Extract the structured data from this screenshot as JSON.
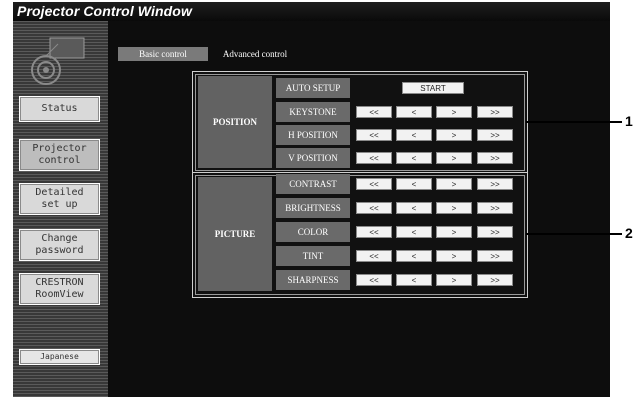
{
  "window": {
    "title": "Projector Control Window"
  },
  "sidebar": {
    "items": [
      {
        "label": "Status"
      },
      {
        "label": "Projector\ncontrol"
      },
      {
        "label": "Detailed\nset up"
      },
      {
        "label": "Change\npassword"
      },
      {
        "label": "CRESTRON\nRoomView"
      }
    ],
    "language_label": "Japanese"
  },
  "tabs": [
    {
      "label": "Basic control",
      "active": true
    },
    {
      "label": "Advanced control",
      "active": false
    }
  ],
  "arrows": {
    "far_left": "<<",
    "left": "<",
    "right": ">",
    "far_right": ">>"
  },
  "position": {
    "label": "POSITION",
    "auto_setup": {
      "label": "AUTO SETUP",
      "button": "START"
    },
    "rows": [
      {
        "label": "KEYSTONE"
      },
      {
        "label": "H POSITION"
      },
      {
        "label": "V POSITION"
      }
    ]
  },
  "picture": {
    "label": "PICTURE",
    "rows": [
      {
        "label": "CONTRAST"
      },
      {
        "label": "BRIGHTNESS"
      },
      {
        "label": "COLOR"
      },
      {
        "label": "TINT"
      },
      {
        "label": "SHARPNESS"
      }
    ]
  },
  "callouts": [
    "1",
    "2"
  ]
}
